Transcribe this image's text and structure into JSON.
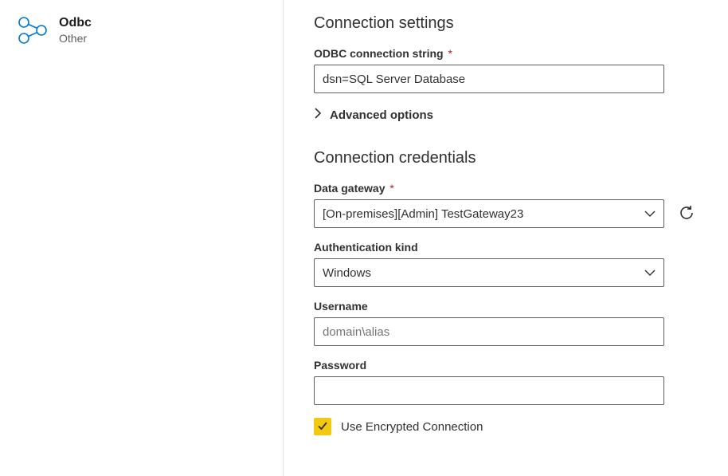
{
  "source": {
    "title": "Odbc",
    "subtitle": "Other",
    "icon": "odbc-icon"
  },
  "settings": {
    "heading": "Connection settings",
    "connection_string": {
      "label": "ODBC connection string",
      "required_mark": "*",
      "value": "dsn=SQL Server Database"
    },
    "advanced_label": "Advanced options"
  },
  "credentials": {
    "heading": "Connection credentials",
    "data_gateway": {
      "label": "Data gateway",
      "required_mark": "*",
      "value": "[On-premises][Admin] TestGateway23"
    },
    "auth_kind": {
      "label": "Authentication kind",
      "value": "Windows"
    },
    "username": {
      "label": "Username",
      "placeholder": "domain\\alias",
      "value": ""
    },
    "password": {
      "label": "Password",
      "value": ""
    },
    "encrypted": {
      "label": "Use Encrypted Connection",
      "checked": true
    }
  }
}
